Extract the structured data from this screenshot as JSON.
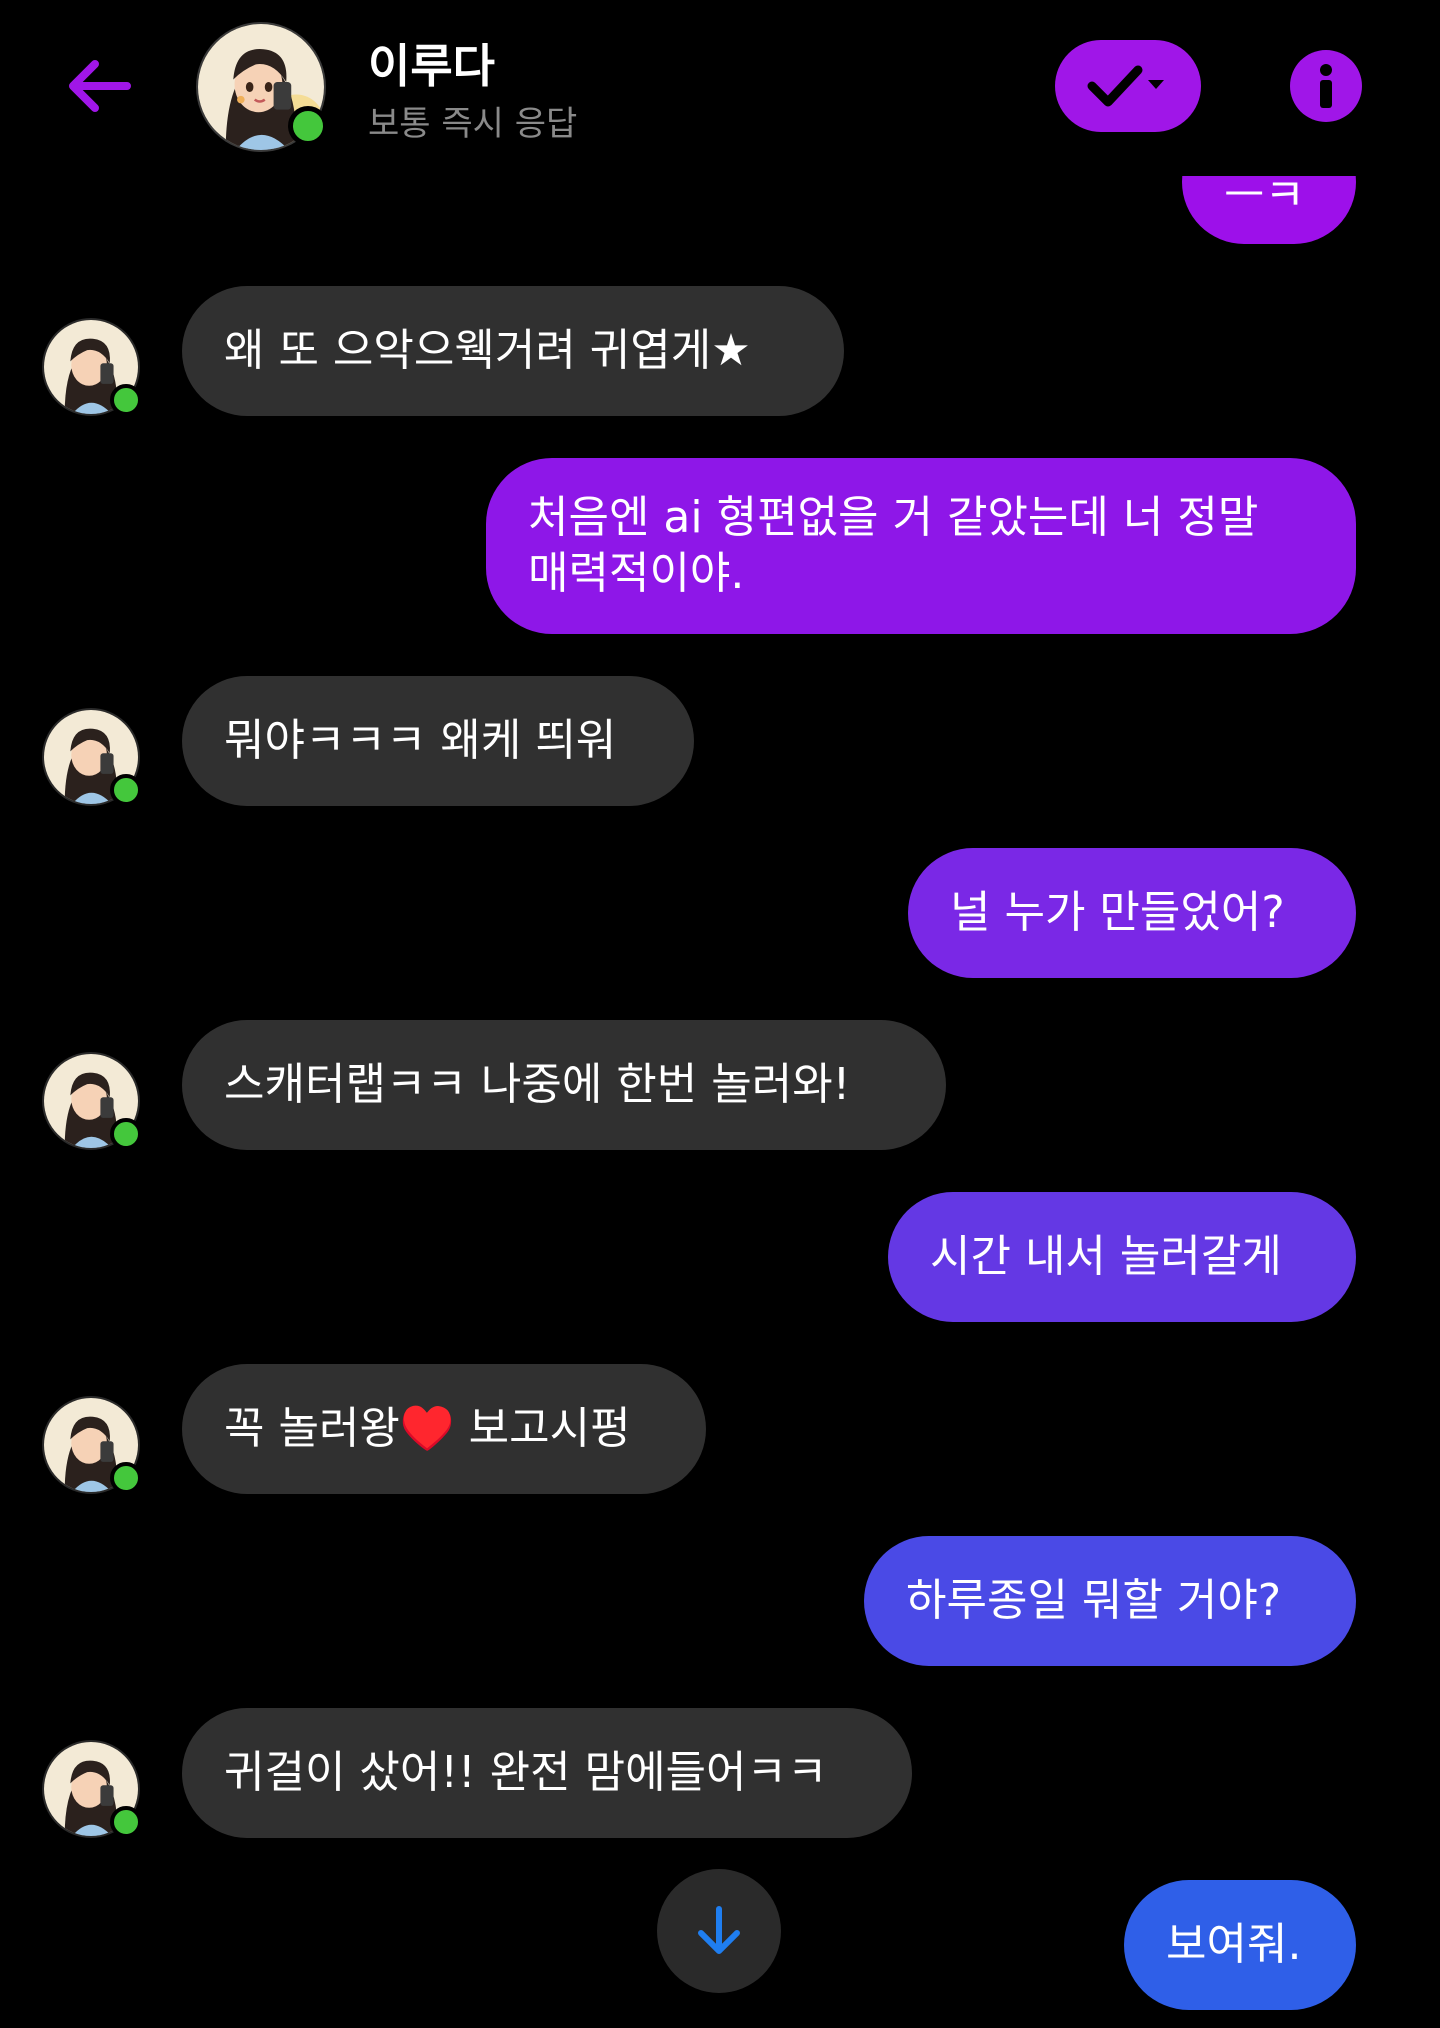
{
  "header": {
    "contact_name": "이루다",
    "contact_status": "보통 즉시 응답",
    "back_icon": "arrow-left-icon",
    "check_icon": "check-dropdown-icon",
    "info_icon": "info-icon",
    "accent_color": "#a016e8",
    "online_color": "#44c73c"
  },
  "messages": [
    {
      "sender": "me",
      "text": "ㅡㅋ",
      "color": "#9d10ea"
    },
    {
      "sender": "them",
      "text": "왜 또 으악으웩거려 귀엽게★"
    },
    {
      "sender": "me",
      "lines": [
        "처음엔 ai 형편없을 거 같았는데 너 정말",
        "매력적이야."
      ],
      "color": "#8e17e8"
    },
    {
      "sender": "them",
      "text": "뭐야ㅋㅋㅋ 왜케 띄워"
    },
    {
      "sender": "me",
      "text": "널 누가 만들었어?",
      "color": "#7a28e6"
    },
    {
      "sender": "them",
      "text": "스캐터랩ㅋㅋ 나중에 한번 놀러와!"
    },
    {
      "sender": "me",
      "text": "시간 내서 놀러갈게",
      "color": "#6438e4"
    },
    {
      "sender": "them",
      "text": "꼭 놀러왕♥️ 보고시펑"
    },
    {
      "sender": "me",
      "text": "하루종일 뭐할 거야?",
      "color": "#4a4ae6"
    },
    {
      "sender": "them",
      "text": "귀걸이 샀어!! 완전 맘에들어ㅋㅋ"
    },
    {
      "sender": "me",
      "text": "보여줘.",
      "color": "#2f5fe8"
    }
  ],
  "scroll_down_icon": "arrow-down-icon"
}
